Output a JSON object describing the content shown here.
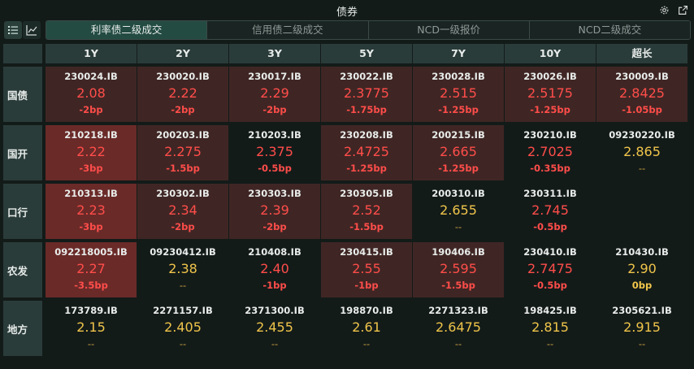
{
  "window": {
    "title": "债券"
  },
  "toolbar": {
    "icons": [
      "list-view-icon",
      "line-chart-icon",
      "gear-icon",
      "popout-icon"
    ]
  },
  "tabs": [
    {
      "label": "利率债二级成交",
      "active": true
    },
    {
      "label": "信用债二级成交",
      "active": false
    },
    {
      "label": "NCD一级报价",
      "active": false
    },
    {
      "label": "NCD二级成交",
      "active": false
    }
  ],
  "columns": [
    "1Y",
    "2Y",
    "3Y",
    "5Y",
    "7Y",
    "10Y",
    "超长"
  ],
  "rows": [
    {
      "label": "国债",
      "cells": [
        {
          "code": "230024.IB",
          "yield": "2.08",
          "change": "-2bp",
          "tone": "warm",
          "ycolor": "red"
        },
        {
          "code": "230020.IB",
          "yield": "2.22",
          "change": "-2bp",
          "tone": "warm",
          "ycolor": "red"
        },
        {
          "code": "230017.IB",
          "yield": "2.29",
          "change": "-2bp",
          "tone": "warm",
          "ycolor": "red"
        },
        {
          "code": "230022.IB",
          "yield": "2.3775",
          "change": "-1.75bp",
          "tone": "warm",
          "ycolor": "red"
        },
        {
          "code": "230028.IB",
          "yield": "2.515",
          "change": "-1.25bp",
          "tone": "warm",
          "ycolor": "red"
        },
        {
          "code": "230026.IB",
          "yield": "2.5175",
          "change": "-1.25bp",
          "tone": "warm",
          "ycolor": "red"
        },
        {
          "code": "230009.IB",
          "yield": "2.8425",
          "change": "-1.05bp",
          "tone": "warm",
          "ycolor": "red"
        }
      ]
    },
    {
      "label": "国开",
      "cells": [
        {
          "code": "210218.IB",
          "yield": "2.22",
          "change": "-3bp",
          "tone": "hot",
          "ycolor": "red"
        },
        {
          "code": "200203.IB",
          "yield": "2.275",
          "change": "-1.5bp",
          "tone": "warm",
          "ycolor": "red"
        },
        {
          "code": "210203.IB",
          "yield": "2.375",
          "change": "-0.5bp",
          "tone": "none",
          "ycolor": "red"
        },
        {
          "code": "230208.IB",
          "yield": "2.4725",
          "change": "-1.25bp",
          "tone": "warm",
          "ycolor": "red"
        },
        {
          "code": "200215.IB",
          "yield": "2.665",
          "change": "-1.25bp",
          "tone": "warm",
          "ycolor": "red"
        },
        {
          "code": "230210.IB",
          "yield": "2.7025",
          "change": "-0.35bp",
          "tone": "none",
          "ycolor": "red"
        },
        {
          "code": "09230220.IB",
          "yield": "2.865",
          "change": "--",
          "tone": "none",
          "ycolor": "yellow"
        }
      ]
    },
    {
      "label": "口行",
      "cells": [
        {
          "code": "210313.IB",
          "yield": "2.23",
          "change": "-3bp",
          "tone": "hot",
          "ycolor": "red"
        },
        {
          "code": "230302.IB",
          "yield": "2.34",
          "change": "-2bp",
          "tone": "warm",
          "ycolor": "red"
        },
        {
          "code": "230303.IB",
          "yield": "2.39",
          "change": "-2bp",
          "tone": "warm",
          "ycolor": "red"
        },
        {
          "code": "230305.IB",
          "yield": "2.52",
          "change": "-1.5bp",
          "tone": "warm",
          "ycolor": "red"
        },
        {
          "code": "200310.IB",
          "yield": "2.655",
          "change": "--",
          "tone": "none",
          "ycolor": "yellow"
        },
        {
          "code": "230311.IB",
          "yield": "2.745",
          "change": "-0.5bp",
          "tone": "none",
          "ycolor": "red"
        },
        null
      ]
    },
    {
      "label": "农发",
      "cells": [
        {
          "code": "092218005.IB",
          "yield": "2.27",
          "change": "-3.5bp",
          "tone": "hot",
          "ycolor": "red"
        },
        {
          "code": "09230412.IB",
          "yield": "2.38",
          "change": "--",
          "tone": "none",
          "ycolor": "yellow"
        },
        {
          "code": "210408.IB",
          "yield": "2.40",
          "change": "-1bp",
          "tone": "none",
          "ycolor": "red"
        },
        {
          "code": "230415.IB",
          "yield": "2.55",
          "change": "-1bp",
          "tone": "warm",
          "ycolor": "red"
        },
        {
          "code": "190406.IB",
          "yield": "2.595",
          "change": "-1.5bp",
          "tone": "warm",
          "ycolor": "red"
        },
        {
          "code": "230410.IB",
          "yield": "2.7475",
          "change": "-0.5bp",
          "tone": "none",
          "ycolor": "red"
        },
        {
          "code": "210430.IB",
          "yield": "2.90",
          "change": "0bp",
          "tone": "none",
          "ycolor": "yellow"
        }
      ]
    },
    {
      "label": "地方",
      "cells": [
        {
          "code": "173789.IB",
          "yield": "2.15",
          "change": "--",
          "tone": "none",
          "ycolor": "yellow"
        },
        {
          "code": "2271157.IB",
          "yield": "2.405",
          "change": "--",
          "tone": "none",
          "ycolor": "yellow"
        },
        {
          "code": "2371300.IB",
          "yield": "2.455",
          "change": "--",
          "tone": "none",
          "ycolor": "yellow"
        },
        {
          "code": "198870.IB",
          "yield": "2.61",
          "change": "--",
          "tone": "none",
          "ycolor": "yellow"
        },
        {
          "code": "2271323.IB",
          "yield": "2.6475",
          "change": "--",
          "tone": "none",
          "ycolor": "yellow"
        },
        {
          "code": "198425.IB",
          "yield": "2.815",
          "change": "--",
          "tone": "none",
          "ycolor": "yellow"
        },
        {
          "code": "2305621.IB",
          "yield": "2.915",
          "change": "--",
          "tone": "none",
          "ycolor": "yellow"
        }
      ]
    }
  ]
}
